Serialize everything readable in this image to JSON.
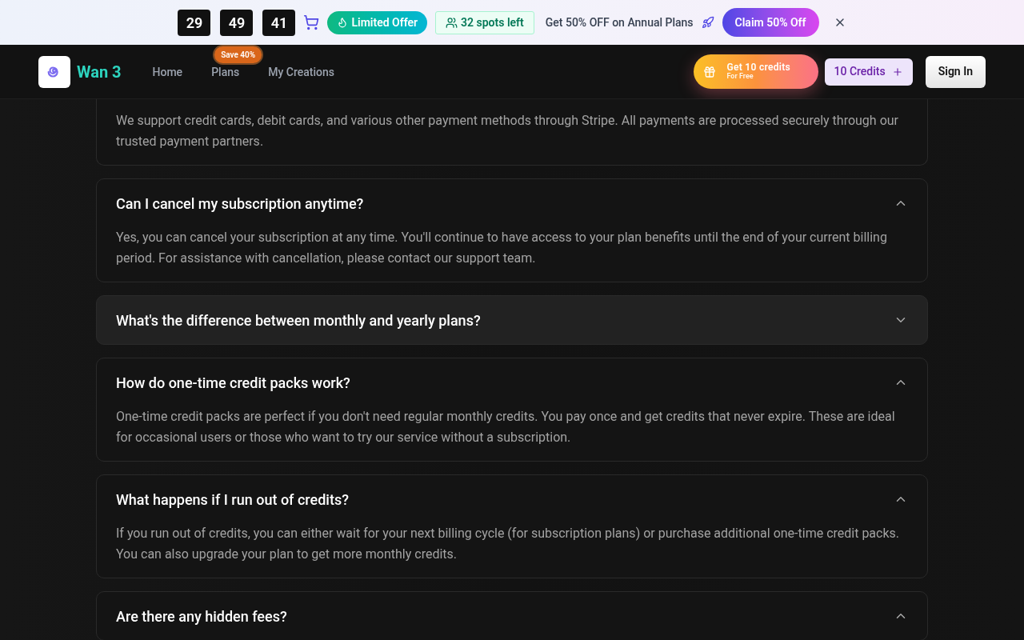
{
  "promo_bar": {
    "countdown": [
      "29",
      "49",
      "41"
    ],
    "offer_badge": "Limited Offer",
    "spots_badge": "32 spots left",
    "message": "Get 50% OFF on Annual Plans",
    "claim_button": "Claim 50% Off"
  },
  "nav": {
    "brand": "Wan 3",
    "links": [
      {
        "label": "Home",
        "selected": false
      },
      {
        "label": "Plans",
        "selected": false
      },
      {
        "label": "My Creations",
        "selected": false
      }
    ],
    "plans_badge": "Save 40%",
    "free_credits": {
      "title": "Get 10 credits",
      "subtitle": "For Free"
    },
    "credits_button": "10 Credits",
    "sign_in": "Sign In"
  },
  "faq": [
    {
      "answer": "We support credit cards, debit cards, and various other payment methods through Stripe. All payments are processed securely through our trusted payment partners.",
      "expanded": true
    },
    {
      "question": "Can I cancel my subscription anytime?",
      "answer": "Yes, you can cancel your subscription at any time. You'll continue to have access to your plan benefits until the end of your current billing period. For assistance with cancellation, please contact our support team.",
      "expanded": true
    },
    {
      "question": "What's the difference between monthly and yearly plans?",
      "expanded": false
    },
    {
      "question": "How do one-time credit packs work?",
      "answer": "One-time credit packs are perfect if you don't need regular monthly credits. You pay once and get credits that never expire. These are ideal for occasional users or those who want to try our service without a subscription.",
      "expanded": true
    },
    {
      "question": "What happens if I run out of credits?",
      "answer": "If you run out of credits, you can either wait for your next billing cycle (for subscription plans) or purchase additional one-time credit packs. You can also upgrade your plan to get more monthly credits.",
      "expanded": true
    },
    {
      "question": "Are there any hidden fees?",
      "expanded": true
    }
  ]
}
